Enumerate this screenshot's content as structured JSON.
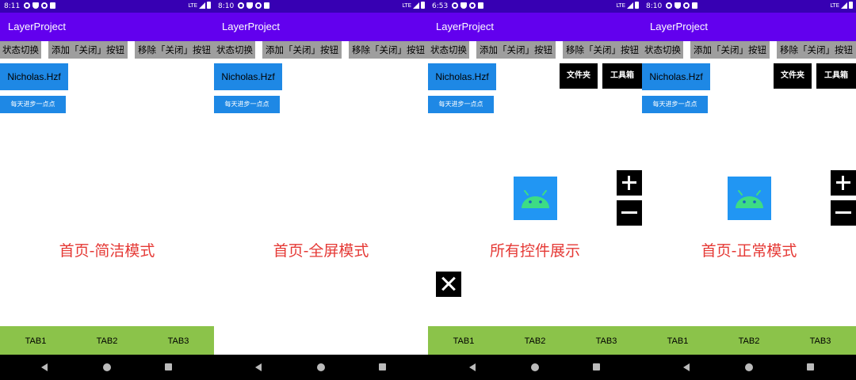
{
  "app_title": "LayerProject",
  "buttons": {
    "state_toggle": "状态切换",
    "add_close": "添加「关闭」按钮",
    "remove_close": "移除「关闭」按钮",
    "nickname": "Nicholas.Hzf",
    "daily": "每天进步一点点",
    "folder": "文件夹",
    "toolbox": "工具箱"
  },
  "tabs": [
    "TAB1",
    "TAB2",
    "TAB3"
  ],
  "status_bar": {
    "network": "LTE"
  },
  "icons": {
    "android": "android-robot-icon",
    "plus": "plus-icon",
    "minus": "minus-icon",
    "close": "close-icon"
  },
  "colors": {
    "status_bar": "#3700b3",
    "app_bar": "#6200ee",
    "accent_button": "#1e88e5",
    "tab_bar": "#8bc34a",
    "headline": "#e53935",
    "android_green": "#3ddc84"
  },
  "screens": [
    {
      "time": "8:11",
      "headline": "首页-简洁模式"
    },
    {
      "time": "8:10",
      "headline": "首页-全屏模式"
    },
    {
      "time": "6:53",
      "headline": "所有控件展示"
    },
    {
      "time": "8:10",
      "headline": "首页-正常模式"
    }
  ]
}
